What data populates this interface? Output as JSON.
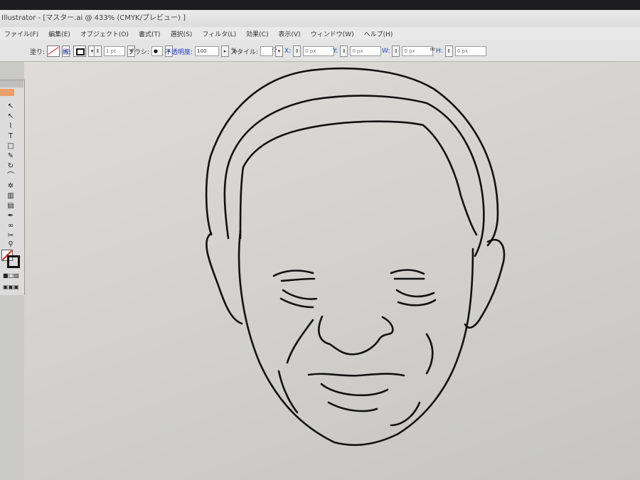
{
  "window": {
    "title": "Illustrator - [マスター.ai @ 433% (CMYK/プレビュー) ]"
  },
  "menu": {
    "items": [
      "ファイル(F)",
      "編集(E)",
      "オブジェクト(O)",
      "書式(T)",
      "選択(S)",
      "フィルタ(L)",
      "効果(C)",
      "表示(V)",
      "ウィンドウ(W)",
      "ヘルプ(H)"
    ]
  },
  "control": {
    "fill_label": "塗り:",
    "stroke_label": "線:",
    "stroke_weight": "1 pt",
    "brush_label": "ブラシ:",
    "opacity_label": "不透明度:",
    "opacity_value": "100",
    "opacity_unit": "%",
    "style_label": "スタイル:",
    "x_label": "X:",
    "x_value": "0 px",
    "y_label": "Y:",
    "y_value": "0 px",
    "w_label": "W:",
    "w_value": "0 px",
    "h_label": "H:",
    "h_value": "0 px"
  },
  "tools": {
    "icons": [
      "selection-tool-icon",
      "direct-selection-tool-icon",
      "lasso-tool-icon",
      "type-tool-icon",
      "rectangle-tool-icon",
      "pencil-tool-icon",
      "rotate-tool-icon",
      "warp-tool-icon",
      "symbol-sprayer-tool-icon",
      "graph-tool-icon",
      "gradient-tool-icon",
      "eyedropper-tool-icon",
      "blend-tool-icon",
      "scissors-tool-icon",
      "zoom-tool-icon"
    ],
    "glyphs": [
      "↖",
      "↖",
      "⌇",
      "T",
      "□",
      "✎",
      "↻",
      "⌒",
      "✲",
      "▥",
      "▤",
      "✒",
      "∞",
      "✂",
      "⚲"
    ]
  },
  "colors": {
    "stroke": "#111111",
    "canvas": "#d6d5d1",
    "link_blue": "#2a43b8"
  }
}
